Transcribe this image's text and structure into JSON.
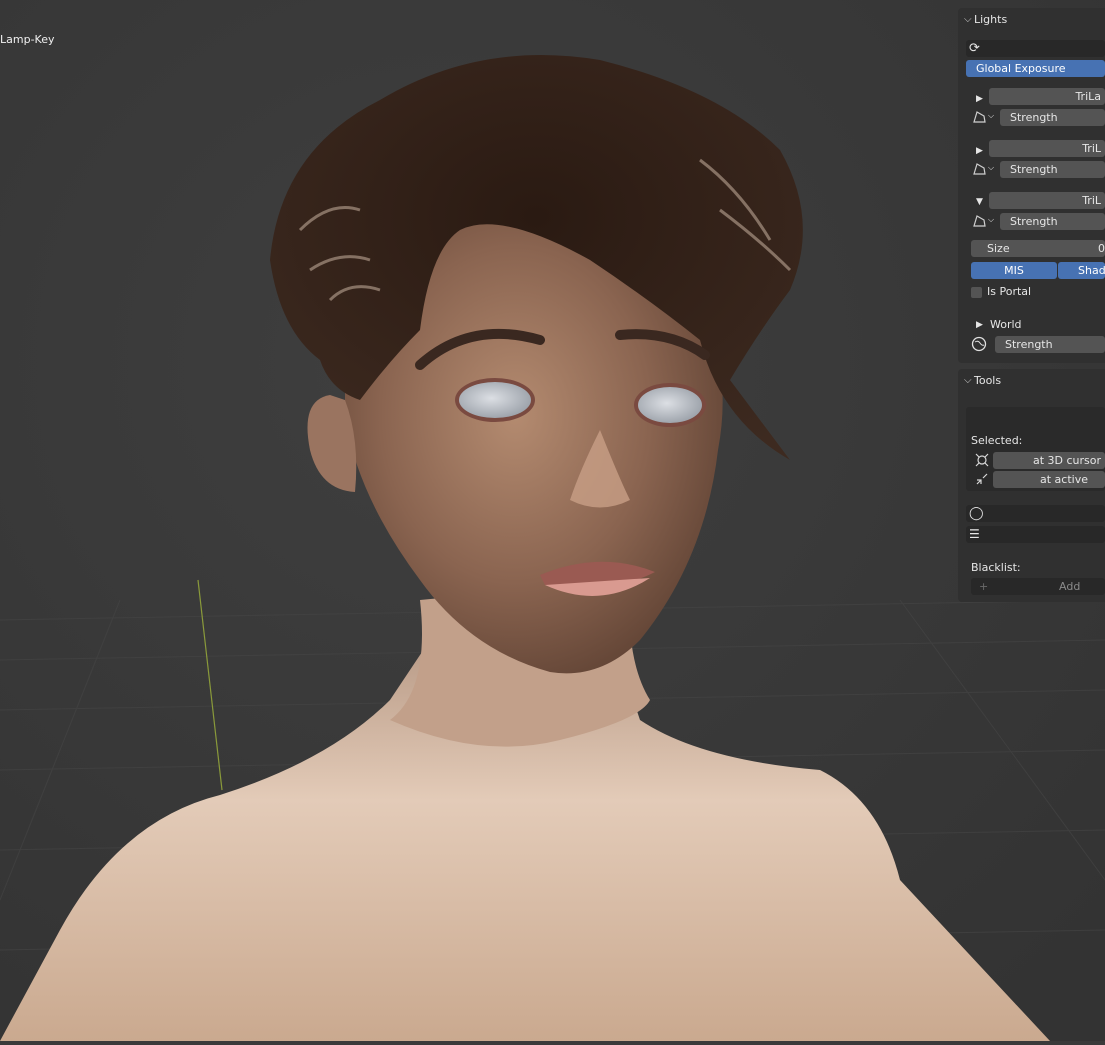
{
  "viewport": {
    "object_label": "Lamp-Key"
  },
  "lights_panel": {
    "header": "Lights",
    "global_exposure_label": "Global Exposure",
    "lamps": [
      {
        "name": "TriLa",
        "strength_label": "Strength"
      },
      {
        "name": "TriL",
        "strength_label": "Strength"
      },
      {
        "name": "TriL",
        "strength_label": "Strength"
      }
    ],
    "size_label": "Size",
    "size_value": "0",
    "mis_label": "MIS",
    "shadow_label": "Shad",
    "is_portal_label": "Is Portal",
    "world_label": "World",
    "world_strength_label": "Strength"
  },
  "tools_panel": {
    "header": "Tools",
    "selected_label": "Selected:",
    "at_3d_cursor_label": "at 3D cursor",
    "at_active_label": "at active",
    "blacklist_label": "Blacklist:",
    "add_label": "Add"
  },
  "colors": {
    "accent": "#4772b3",
    "panel_bg": "#303030",
    "field_bg": "#545454",
    "viewport_bg": "#3a3a3a"
  }
}
